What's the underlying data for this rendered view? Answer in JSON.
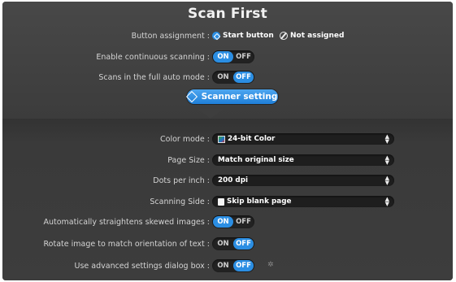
{
  "title": "Scan First",
  "button_assignment": {
    "label": "Button assignment :",
    "options": [
      "Start button",
      "Not assigned"
    ],
    "selected": "Start button"
  },
  "continuous_scanning": {
    "label": "Enable continuous scanning :",
    "on": "ON",
    "off": "OFF",
    "state": "ON"
  },
  "full_auto": {
    "label": "Scans in the full auto mode :",
    "on": "ON",
    "off": "OFF",
    "state": "OFF"
  },
  "scanner_setting_button": "Scanner setting",
  "color_mode": {
    "label": "Color mode :",
    "value": "24-bit Color",
    "icon": "color-mode-icon"
  },
  "page_size": {
    "label": "Page Size :",
    "value": "Match original size"
  },
  "dpi": {
    "label": "Dots per inch :",
    "value": "200 dpi"
  },
  "scanning_side": {
    "label": "Scanning Side :",
    "value": "Skip blank page",
    "icon": "page-icon"
  },
  "straighten": {
    "label": "Automatically straightens skewed images :",
    "on": "ON",
    "off": "OFF",
    "state": "ON"
  },
  "rotate": {
    "label": "Rotate image to match orientation of text :",
    "on": "ON",
    "off": "OFF",
    "state": "OFF"
  },
  "advanced": {
    "label": "Use advanced settings dialog box :",
    "on": "ON",
    "off": "OFF",
    "state": "OFF",
    "extra_icon": "gear-icon"
  },
  "colors": {
    "accent": "#2b8ee3",
    "panel_bg": "#3a3a3a",
    "text": "#d4d4d4"
  }
}
